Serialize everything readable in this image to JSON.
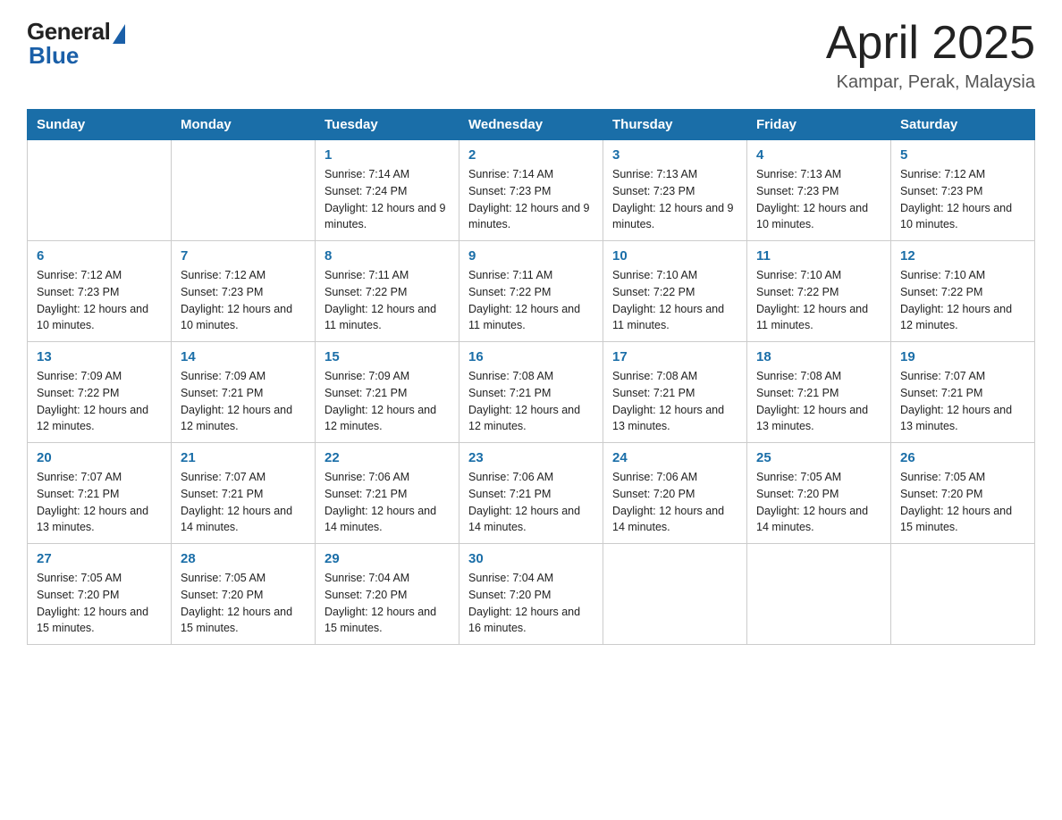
{
  "header": {
    "logo_general": "General",
    "logo_blue": "Blue",
    "month_title": "April 2025",
    "location": "Kampar, Perak, Malaysia"
  },
  "days_of_week": [
    "Sunday",
    "Monday",
    "Tuesday",
    "Wednesday",
    "Thursday",
    "Friday",
    "Saturday"
  ],
  "weeks": [
    [
      {
        "day": "",
        "sunrise": "",
        "sunset": "",
        "daylight": ""
      },
      {
        "day": "",
        "sunrise": "",
        "sunset": "",
        "daylight": ""
      },
      {
        "day": "1",
        "sunrise": "Sunrise: 7:14 AM",
        "sunset": "Sunset: 7:24 PM",
        "daylight": "Daylight: 12 hours and 9 minutes."
      },
      {
        "day": "2",
        "sunrise": "Sunrise: 7:14 AM",
        "sunset": "Sunset: 7:23 PM",
        "daylight": "Daylight: 12 hours and 9 minutes."
      },
      {
        "day": "3",
        "sunrise": "Sunrise: 7:13 AM",
        "sunset": "Sunset: 7:23 PM",
        "daylight": "Daylight: 12 hours and 9 minutes."
      },
      {
        "day": "4",
        "sunrise": "Sunrise: 7:13 AM",
        "sunset": "Sunset: 7:23 PM",
        "daylight": "Daylight: 12 hours and 10 minutes."
      },
      {
        "day": "5",
        "sunrise": "Sunrise: 7:12 AM",
        "sunset": "Sunset: 7:23 PM",
        "daylight": "Daylight: 12 hours and 10 minutes."
      }
    ],
    [
      {
        "day": "6",
        "sunrise": "Sunrise: 7:12 AM",
        "sunset": "Sunset: 7:23 PM",
        "daylight": "Daylight: 12 hours and 10 minutes."
      },
      {
        "day": "7",
        "sunrise": "Sunrise: 7:12 AM",
        "sunset": "Sunset: 7:23 PM",
        "daylight": "Daylight: 12 hours and 10 minutes."
      },
      {
        "day": "8",
        "sunrise": "Sunrise: 7:11 AM",
        "sunset": "Sunset: 7:22 PM",
        "daylight": "Daylight: 12 hours and 11 minutes."
      },
      {
        "day": "9",
        "sunrise": "Sunrise: 7:11 AM",
        "sunset": "Sunset: 7:22 PM",
        "daylight": "Daylight: 12 hours and 11 minutes."
      },
      {
        "day": "10",
        "sunrise": "Sunrise: 7:10 AM",
        "sunset": "Sunset: 7:22 PM",
        "daylight": "Daylight: 12 hours and 11 minutes."
      },
      {
        "day": "11",
        "sunrise": "Sunrise: 7:10 AM",
        "sunset": "Sunset: 7:22 PM",
        "daylight": "Daylight: 12 hours and 11 minutes."
      },
      {
        "day": "12",
        "sunrise": "Sunrise: 7:10 AM",
        "sunset": "Sunset: 7:22 PM",
        "daylight": "Daylight: 12 hours and 12 minutes."
      }
    ],
    [
      {
        "day": "13",
        "sunrise": "Sunrise: 7:09 AM",
        "sunset": "Sunset: 7:22 PM",
        "daylight": "Daylight: 12 hours and 12 minutes."
      },
      {
        "day": "14",
        "sunrise": "Sunrise: 7:09 AM",
        "sunset": "Sunset: 7:21 PM",
        "daylight": "Daylight: 12 hours and 12 minutes."
      },
      {
        "day": "15",
        "sunrise": "Sunrise: 7:09 AM",
        "sunset": "Sunset: 7:21 PM",
        "daylight": "Daylight: 12 hours and 12 minutes."
      },
      {
        "day": "16",
        "sunrise": "Sunrise: 7:08 AM",
        "sunset": "Sunset: 7:21 PM",
        "daylight": "Daylight: 12 hours and 12 minutes."
      },
      {
        "day": "17",
        "sunrise": "Sunrise: 7:08 AM",
        "sunset": "Sunset: 7:21 PM",
        "daylight": "Daylight: 12 hours and 13 minutes."
      },
      {
        "day": "18",
        "sunrise": "Sunrise: 7:08 AM",
        "sunset": "Sunset: 7:21 PM",
        "daylight": "Daylight: 12 hours and 13 minutes."
      },
      {
        "day": "19",
        "sunrise": "Sunrise: 7:07 AM",
        "sunset": "Sunset: 7:21 PM",
        "daylight": "Daylight: 12 hours and 13 minutes."
      }
    ],
    [
      {
        "day": "20",
        "sunrise": "Sunrise: 7:07 AM",
        "sunset": "Sunset: 7:21 PM",
        "daylight": "Daylight: 12 hours and 13 minutes."
      },
      {
        "day": "21",
        "sunrise": "Sunrise: 7:07 AM",
        "sunset": "Sunset: 7:21 PM",
        "daylight": "Daylight: 12 hours and 14 minutes."
      },
      {
        "day": "22",
        "sunrise": "Sunrise: 7:06 AM",
        "sunset": "Sunset: 7:21 PM",
        "daylight": "Daylight: 12 hours and 14 minutes."
      },
      {
        "day": "23",
        "sunrise": "Sunrise: 7:06 AM",
        "sunset": "Sunset: 7:21 PM",
        "daylight": "Daylight: 12 hours and 14 minutes."
      },
      {
        "day": "24",
        "sunrise": "Sunrise: 7:06 AM",
        "sunset": "Sunset: 7:20 PM",
        "daylight": "Daylight: 12 hours and 14 minutes."
      },
      {
        "day": "25",
        "sunrise": "Sunrise: 7:05 AM",
        "sunset": "Sunset: 7:20 PM",
        "daylight": "Daylight: 12 hours and 14 minutes."
      },
      {
        "day": "26",
        "sunrise": "Sunrise: 7:05 AM",
        "sunset": "Sunset: 7:20 PM",
        "daylight": "Daylight: 12 hours and 15 minutes."
      }
    ],
    [
      {
        "day": "27",
        "sunrise": "Sunrise: 7:05 AM",
        "sunset": "Sunset: 7:20 PM",
        "daylight": "Daylight: 12 hours and 15 minutes."
      },
      {
        "day": "28",
        "sunrise": "Sunrise: 7:05 AM",
        "sunset": "Sunset: 7:20 PM",
        "daylight": "Daylight: 12 hours and 15 minutes."
      },
      {
        "day": "29",
        "sunrise": "Sunrise: 7:04 AM",
        "sunset": "Sunset: 7:20 PM",
        "daylight": "Daylight: 12 hours and 15 minutes."
      },
      {
        "day": "30",
        "sunrise": "Sunrise: 7:04 AM",
        "sunset": "Sunset: 7:20 PM",
        "daylight": "Daylight: 12 hours and 16 minutes."
      },
      {
        "day": "",
        "sunrise": "",
        "sunset": "",
        "daylight": ""
      },
      {
        "day": "",
        "sunrise": "",
        "sunset": "",
        "daylight": ""
      },
      {
        "day": "",
        "sunrise": "",
        "sunset": "",
        "daylight": ""
      }
    ]
  ]
}
